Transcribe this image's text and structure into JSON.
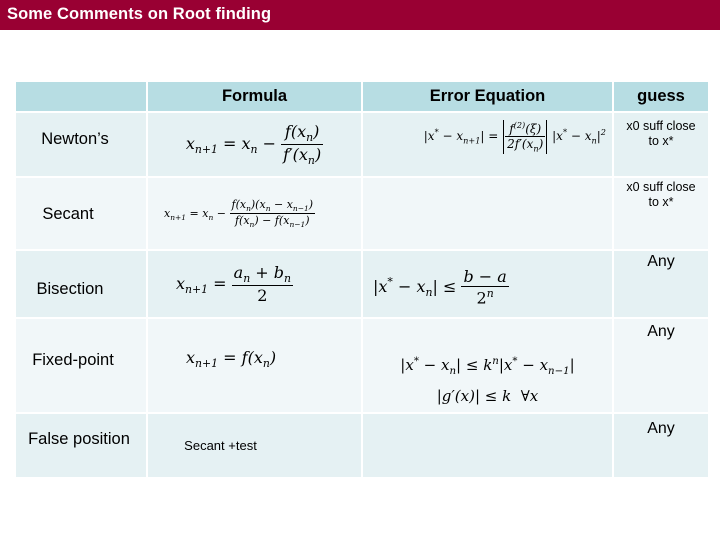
{
  "header": {
    "title": "Some Comments on Root finding",
    "bg_color": "#990033"
  },
  "table": {
    "columns": [
      "",
      "Formula",
      "Error Equation",
      "guess"
    ],
    "rows": [
      {
        "method": "Newton’s",
        "formula": "x_{n+1} = x_n − f(x_n) / f′(x_n)",
        "error": "|x* − x_{n+1}| = |f^{(2)}(ξ) / 2f′(x_n)| |x* − x_n|^2",
        "guess": "x0 suff close to x*"
      },
      {
        "method": "Secant",
        "formula": "x_{n+1} = x_n − f(x_n)(x_n − x_{n−1}) / (f(x_n) − f(x_{n−1}))",
        "error": "",
        "guess": "x0 suff close to x*"
      },
      {
        "method": "Bisection",
        "formula": "x_{n+1} = (a_n + b_n) / 2",
        "error": "|x* − x_n| ≤ (b − a) / 2^n",
        "guess": "Any"
      },
      {
        "method": "Fixed-point",
        "formula": "x_{n+1} = f(x_n)",
        "error": "|x* − x_n| ≤ k^n |x* − x_{n−1}| ; |g′(x)| ≤ k ∀x",
        "guess": "Any"
      },
      {
        "method": "False position",
        "formula": "Secant +test",
        "error": "",
        "guess": "Any"
      }
    ]
  },
  "labels": {
    "guess_line1": "x0 suff close",
    "guess_line2": "to x*",
    "secant_test": "Secant +test"
  },
  "colors": {
    "header_row": "#b7dde3",
    "row_odd": "#e5f1f3",
    "row_even": "#f1f7f9"
  }
}
